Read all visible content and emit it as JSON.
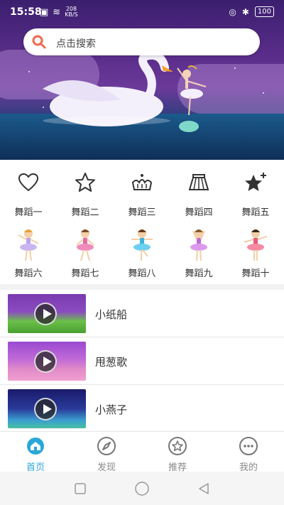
{
  "status_bar": {
    "time": "15:58",
    "speed_value": "208",
    "speed_unit": "KB/S",
    "battery": "100"
  },
  "search": {
    "placeholder": "点击搜索",
    "icon": "search-icon"
  },
  "categories_row1": [
    {
      "label": "舞蹈一",
      "icon": "heart-icon"
    },
    {
      "label": "舞蹈二",
      "icon": "star-icon"
    },
    {
      "label": "舞蹈三",
      "icon": "crown-icon"
    },
    {
      "label": "舞蹈四",
      "icon": "skirt-icon"
    },
    {
      "label": "舞蹈五",
      "icon": "star-plus-icon"
    }
  ],
  "categories_row2": [
    {
      "label": "舞蹈六",
      "icon": "ballerina-icon"
    },
    {
      "label": "舞蹈七",
      "icon": "ballerina-icon"
    },
    {
      "label": "舞蹈八",
      "icon": "ballerina-icon"
    },
    {
      "label": "舞蹈九",
      "icon": "ballerina-icon"
    },
    {
      "label": "舞蹈十",
      "icon": "ballerina-icon"
    }
  ],
  "videos": [
    {
      "title": "小纸船"
    },
    {
      "title": "甩葱歌"
    },
    {
      "title": "小燕子"
    }
  ],
  "tabs": [
    {
      "label": "首页",
      "icon": "home-icon",
      "active": true
    },
    {
      "label": "发现",
      "icon": "compass-icon",
      "active": false
    },
    {
      "label": "推荐",
      "icon": "star-circle-icon",
      "active": false
    },
    {
      "label": "我的",
      "icon": "more-circle-icon",
      "active": false
    }
  ],
  "colors": {
    "accent": "#2aa7d8",
    "search_icon": "#f0694f"
  }
}
